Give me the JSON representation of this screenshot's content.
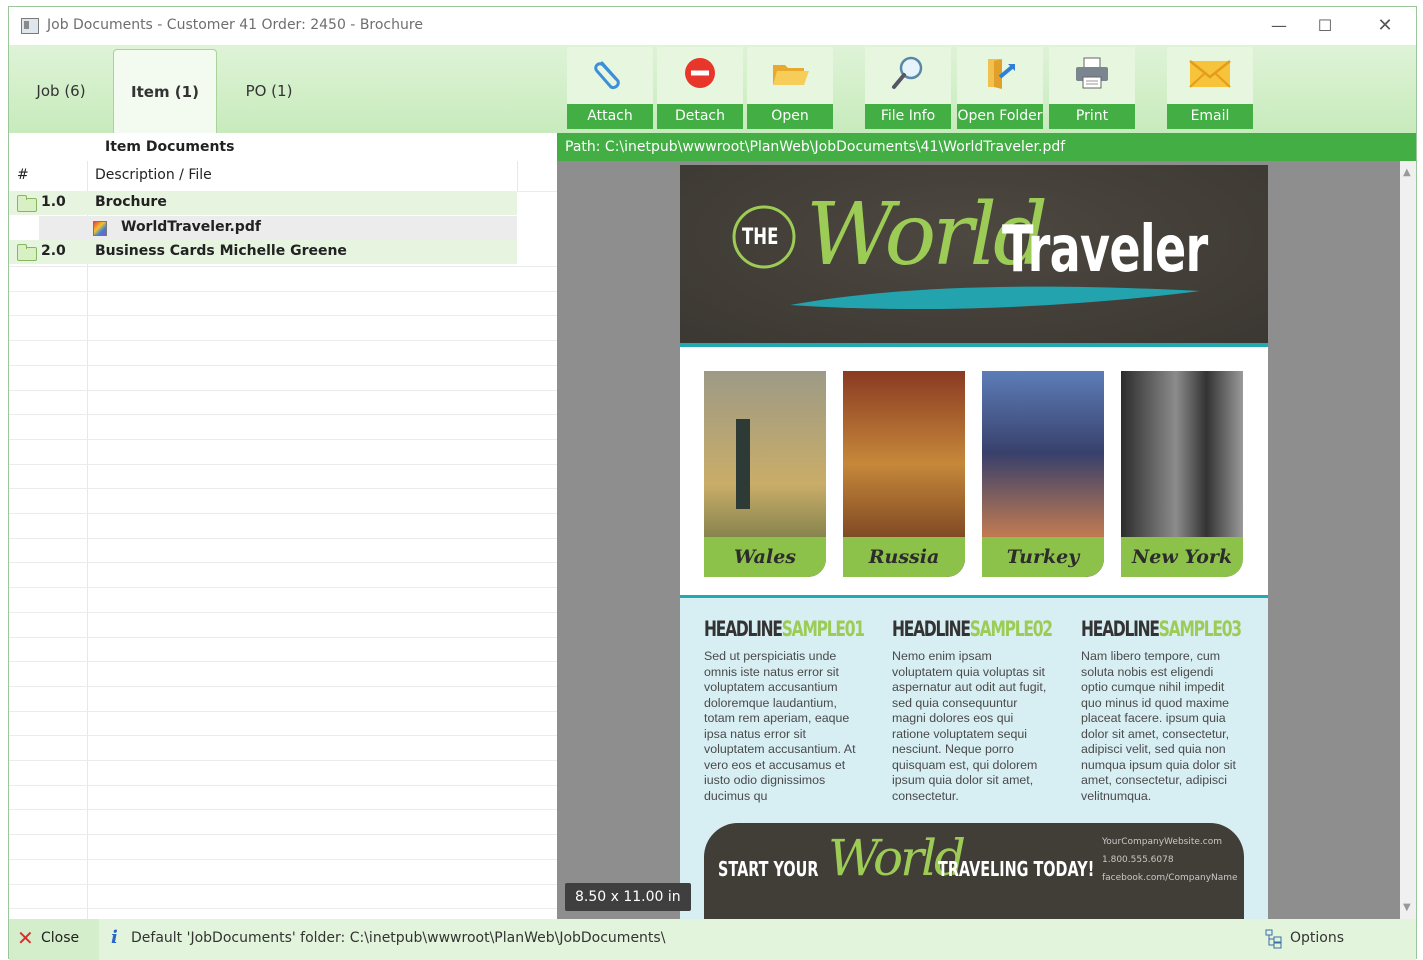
{
  "window": {
    "title": "Job Documents - Customer 41 Order: 2450 - Brochure",
    "controls": {
      "minimize": "—",
      "maximize": "☐",
      "close": "✕"
    }
  },
  "tabs": [
    {
      "label": "Job (6)",
      "active": false
    },
    {
      "label": "Item (1)",
      "active": true
    },
    {
      "label": "PO (1)",
      "active": false
    }
  ],
  "toolbar": [
    {
      "label": "Attach",
      "icon": "paperclip-icon"
    },
    {
      "label": "Detach",
      "icon": "remove-icon"
    },
    {
      "label": "Open",
      "icon": "folder-open-icon"
    },
    {
      "label": "File Info",
      "icon": "magnifier-icon"
    },
    {
      "label": "Open Folder",
      "icon": "open-folder-icon"
    },
    {
      "label": "Print",
      "icon": "printer-icon"
    },
    {
      "label": "Email",
      "icon": "envelope-icon"
    }
  ],
  "panel": {
    "title": "Item Documents",
    "columns": [
      "#",
      "Description / File"
    ],
    "rows": [
      {
        "num": "1.0",
        "desc": "Brochure",
        "type": "folder"
      },
      {
        "num": "",
        "desc": "WorldTraveler.pdf",
        "type": "file",
        "selected": true
      },
      {
        "num": "2.0",
        "desc": "Business Cards Michelle Greene",
        "type": "folder"
      }
    ]
  },
  "path": "Path: C:\\inetpub\\wwwroot\\PlanWeb\\JobDocuments\\41\\WorldTraveler.pdf",
  "document": {
    "hero": {
      "the": "THE",
      "world": "World",
      "traveler": "Traveler"
    },
    "photos": [
      "Wales",
      "Russia",
      "Turkey",
      "New York"
    ],
    "columns": [
      {
        "head_a": "HEADLINE",
        "head_b": "SAMPLE01",
        "body": "Sed ut perspiciatis unde omnis iste natus error sit voluptatem accusantium doloremque laudantium, totam rem aperiam, eaque ipsa natus error sit voluptatem accusantium. At vero eos et accusamus et iusto odio dignissimos ducimus qu"
      },
      {
        "head_a": "HEADLINE",
        "head_b": "SAMPLE02",
        "body": "Nemo enim ipsam voluptatem quia voluptas sit aspernatur aut odit aut fugit, sed quia consequuntur magni dolores eos qui ratione voluptatem sequi nesciunt. Neque porro quisquam est, qui dolorem ipsum quia dolor sit amet, consectetur."
      },
      {
        "head_a": "HEADLINE",
        "head_b": "SAMPLE03",
        "body": "Nam libero tempore, cum soluta nobis est eligendi optio cumque nihil impedit quo minus id quod maxime placeat facere. ipsum quia dolor sit amet, consectetur, adipisci velit, sed quia non numqua ipsum quia dolor sit amet, consectetur, adipisci velitnumqua."
      }
    ],
    "banner": {
      "start": "START YOUR",
      "world": "World",
      "end": "TRAVELING TODAY!",
      "contacts": [
        "YourCompanyWebsite.com",
        "1.800.555.6078",
        "facebook.com/CompanyName"
      ]
    }
  },
  "page_size": "8.50 x 11.00 in",
  "status": {
    "close_label": "Close",
    "default_folder": "Default 'JobDocuments' folder: C:\\inetpub\\wwwroot\\PlanWeb\\JobDocuments\\",
    "options_label": "Options"
  },
  "colors": {
    "accent_green": "#42ae44",
    "ribbon_green": "#cdeec2",
    "brochure_teal": "#21a9b4",
    "brochure_lime": "#9ccc55"
  }
}
